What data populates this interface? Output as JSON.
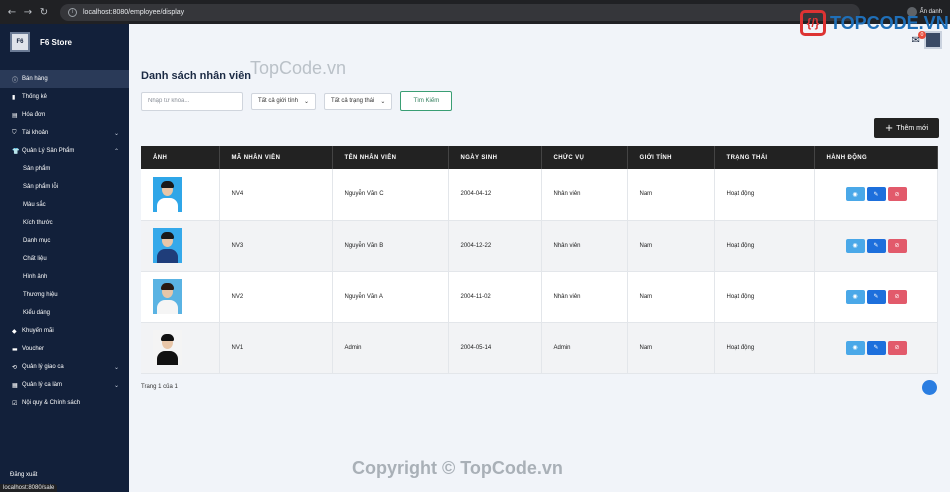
{
  "browser": {
    "url": "localhost:8080/employee/display",
    "profile_label": "Ẩn danh",
    "status_url": "localhost:8080/sale"
  },
  "watermark": {
    "logo_text": "TOPCODE.VN",
    "faint_text": "TopCode.vn",
    "copyright": "Copyright © TopCode.vn"
  },
  "sidebar": {
    "brand": "F6 Store",
    "logo_text": "F6",
    "items": [
      {
        "label": "Bán hàng",
        "icon": "ⓘ",
        "active": true
      },
      {
        "label": "Thống kê",
        "icon": "▮"
      },
      {
        "label": "Hóa đơn",
        "icon": "▤"
      },
      {
        "label": "Tài khoản",
        "icon": "⛉",
        "chevron": "⌄"
      },
      {
        "label": "Quản Lý Sản Phẩm",
        "icon": "👕",
        "chevron": "⌃"
      }
    ],
    "sub_items": [
      "Sản phẩm",
      "Sản phẩm lỗi",
      "Màu sắc",
      "Kích thước",
      "Danh mục",
      "Chất liệu",
      "Hình ảnh",
      "Thương hiệu",
      "Kiểu dáng"
    ],
    "items_after": [
      {
        "label": "Khuyến mãi",
        "icon": "◆"
      },
      {
        "label": "Voucher",
        "icon": "▬"
      },
      {
        "label": "Quản lý giao ca",
        "icon": "⟲",
        "chevron": "⌄"
      },
      {
        "label": "Quản lý ca làm",
        "icon": "▦",
        "chevron": "⌄"
      },
      {
        "label": "Nội quy & Chính sách",
        "icon": "☑"
      }
    ],
    "logout": "Đăng xuất"
  },
  "topbar": {
    "mail_count": "0"
  },
  "main": {
    "title": "Danh sách nhân viên",
    "search_placeholder": "Nhập từ khóa...",
    "gender_filter": "Tất cả giới tính",
    "status_filter": "Tất cả trạng thái",
    "search_button": "Tìm Kiếm",
    "add_button": "Thêm mới",
    "columns": [
      "ẢNH",
      "MÃ NHÂN VIÊN",
      "TÊN NHÂN VIÊN",
      "NGÀY SINH",
      "CHỨC VỤ",
      "GIỚI TÍNH",
      "TRẠNG THÁI",
      "HÀNH ĐỘNG"
    ],
    "rows": [
      {
        "code": "NV4",
        "name": "Nguyễn Văn C",
        "dob": "2004-04-12",
        "role": "Nhân viên",
        "gender": "Nam",
        "status": "Hoạt động"
      },
      {
        "code": "NV3",
        "name": "Nguyễn Văn B",
        "dob": "2004-12-22",
        "role": "Nhân viên",
        "gender": "Nam",
        "status": "Hoạt động"
      },
      {
        "code": "NV2",
        "name": "Nguyễn Văn A",
        "dob": "2004-11-02",
        "role": "Nhân viên",
        "gender": "Nam",
        "status": "Hoạt động"
      },
      {
        "code": "NV1",
        "name": "Admin",
        "dob": "2004-05-14",
        "role": "Admin",
        "gender": "Nam",
        "status": "Hoạt động"
      }
    ],
    "pager": "Trang 1 của 1"
  },
  "colors": {
    "sidebar_bg": "#12203a",
    "header_bg": "#222222",
    "view_btn": "#4aa8e8",
    "edit_btn": "#1d6fdc",
    "delete_btn": "#e25a6b",
    "search_btn_border": "#3a9e74"
  }
}
